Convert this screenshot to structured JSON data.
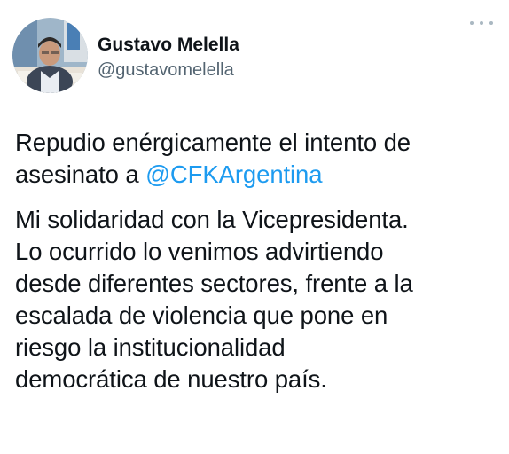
{
  "author": {
    "display_name": "Gustavo Melella",
    "handle": "@gustavomelella",
    "avatar_icon": "profile-photo"
  },
  "menu": {
    "icon": "more-horizontal-icon"
  },
  "tweet": {
    "paragraph1": {
      "line1": "Repudio enérgicamente el intento de",
      "line2_prefix": "asesinato a ",
      "mention": "@CFKArgentina"
    },
    "paragraph2": {
      "lines": [
        "Mi solidaridad con la Vicepresidenta.",
        "Lo ocurrido lo venimos advirtiendo",
        "desde diferentes sectores, frente a la",
        "escalada de violencia que pone en",
        "riesgo la institucionalidad",
        "democrática de nuestro país."
      ]
    }
  },
  "colors": {
    "text": "#0f1419",
    "secondary": "#536471",
    "link": "#1d9bf0"
  }
}
